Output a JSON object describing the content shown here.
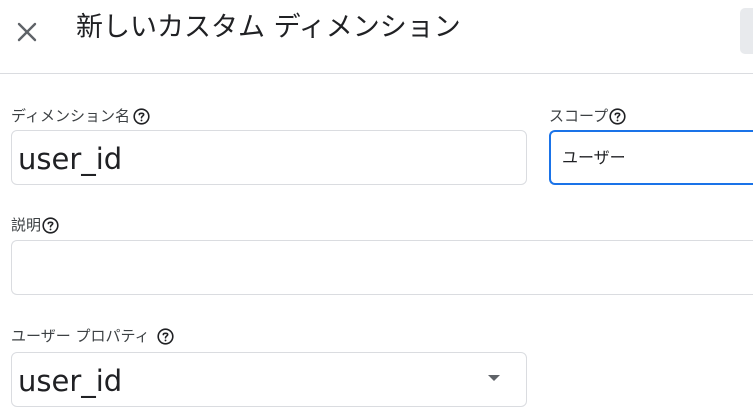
{
  "header": {
    "title": "新しいカスタム ディメンション",
    "close_icon": "close-icon"
  },
  "form": {
    "dimension_name": {
      "label": "ディメンション名",
      "value": "user_id"
    },
    "scope": {
      "label": "スコープ",
      "value": "ユーザー"
    },
    "description": {
      "label": "説明",
      "value": ""
    },
    "user_property": {
      "label": "ユーザー プロパティ",
      "value": "user_id"
    }
  },
  "colors": {
    "focus_border": "#1a73e8",
    "border": "#dadce0",
    "text": "#202124"
  }
}
